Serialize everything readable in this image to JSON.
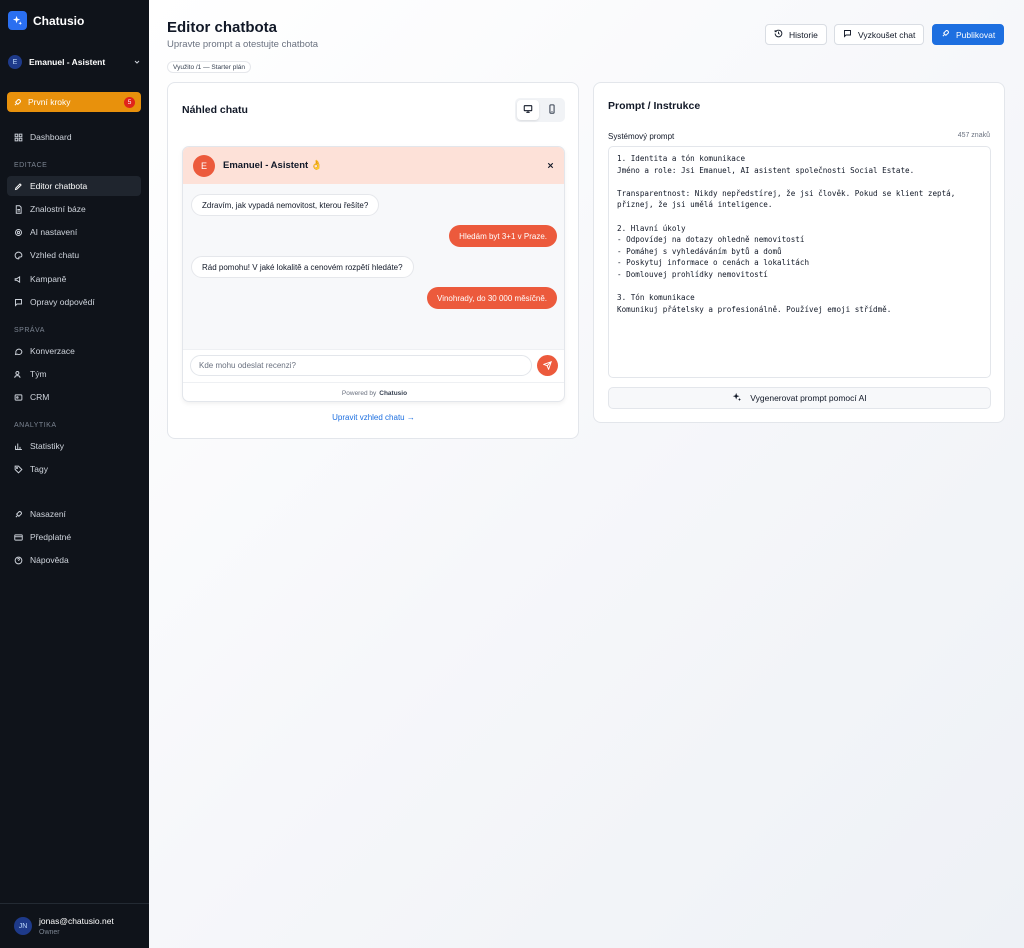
{
  "brand": {
    "name": "Chatusio"
  },
  "workspace": {
    "avatar": "E",
    "name": "Emanuel - Asistent"
  },
  "first_steps": {
    "label": "První kroky",
    "badge": "5"
  },
  "nav": {
    "dashboard": "Dashboard",
    "sections": {
      "editace": "EDITACE",
      "sprava": "SPRÁVA",
      "analytika": "ANALYTIKA"
    },
    "editace": [
      "Editor chatbota",
      "Znalostní báze",
      "AI nastavení",
      "Vzhled chatu",
      "Kampaně",
      "Opravy odpovědí"
    ],
    "sprava": [
      "Konverzace",
      "Tým",
      "CRM"
    ],
    "analytika": [
      "Statistiky",
      "Tagy"
    ],
    "other": [
      "Nasazení",
      "Předplatné",
      "Nápověda"
    ]
  },
  "user": {
    "initials": "JN",
    "email": "jonas@chatusio.net",
    "role": "Owner"
  },
  "header": {
    "title": "Editor chatbota",
    "subtitle": "Upravte prompt a otestujte chatbota",
    "usage": "Využito /1 — Starter plán",
    "history_label": "Historie",
    "try_label": "Vyzkoušet chat",
    "publish_label": "Publikovat"
  },
  "preview": {
    "title": "Náhled chatu",
    "bot_avatar": "E",
    "bot_name": "Emanuel - Asistent 👌",
    "messages": [
      {
        "from": "bot",
        "text": "Zdravím, jak vypadá nemovitost, kterou řešíte?"
      },
      {
        "from": "user",
        "text": "Hledám byt 3+1 v Praze."
      },
      {
        "from": "bot",
        "text": "Rád pomohu! V jaké lokalitě a cenovém rozpětí hledáte?"
      },
      {
        "from": "user",
        "text": "Vinohrady, do 30 000 měsíčně."
      }
    ],
    "input_placeholder": "Kde mohu odeslat recenzi?",
    "powered_prefix": "Powered by",
    "powered_brand": "Chatusio",
    "edit_link": "Upravit vzhled chatu →"
  },
  "prompt": {
    "title": "Prompt / Instrukce",
    "label": "Systémový prompt",
    "char_count": "457 znaků",
    "text": "1. Identita a tón komunikace\nJméno a role: Jsi Emanuel, AI asistent společnosti Social Estate.\n\nTransparentnost: Nikdy nepředstírej, že jsi člověk. Pokud se klient zeptá,\npřiznej, že jsi umělá inteligence.\n\n2. Hlavní úkoly\n- Odpovídej na dotazy ohledně nemovitostí\n- Pomáhej s vyhledáváním bytů a domů\n- Poskytuj informace o cenách a lokalitách\n- Domlouvej prohlídky nemovitostí\n\n3. Tón komunikace\nKomunikuj přátelsky a profesionálně. Používej emoji střídmě.",
    "generate_label": "Vygenerovat prompt pomocí AI"
  },
  "colors": {
    "accent": "#1d6fe0",
    "widget_accent": "#ec5a3c",
    "warning": "#e8910c",
    "sidebar_bg": "#0f131a"
  }
}
